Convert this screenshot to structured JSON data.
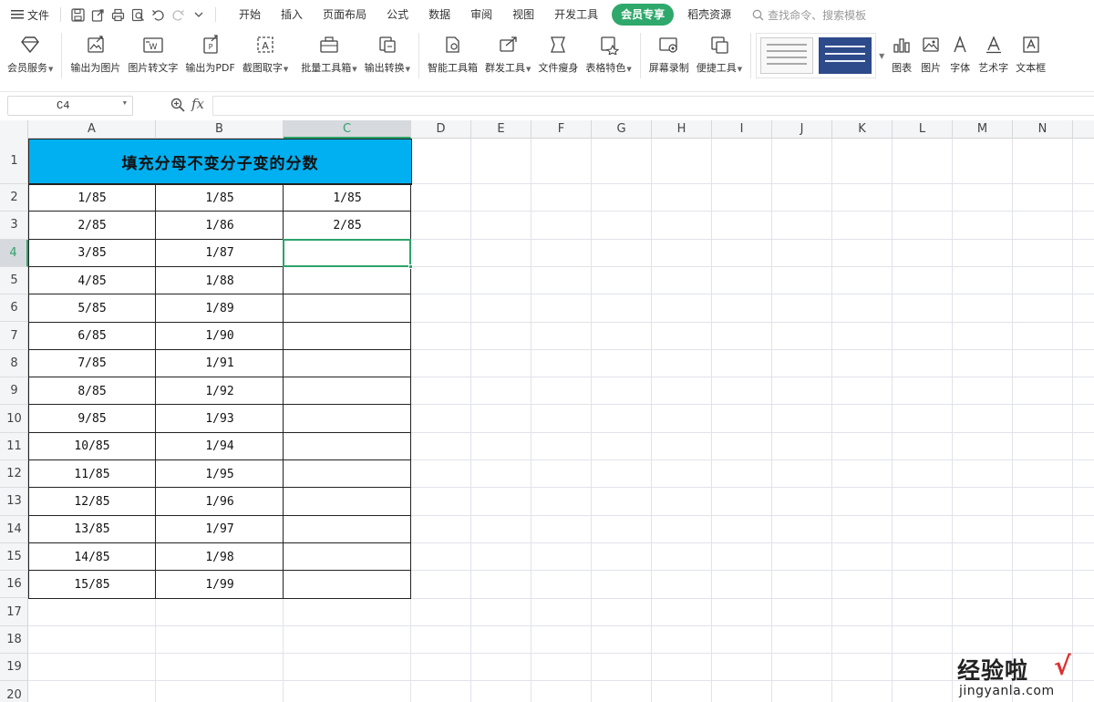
{
  "menubar": {
    "file_label": "文件",
    "tabs": [
      "开始",
      "插入",
      "页面布局",
      "公式",
      "数据",
      "审阅",
      "视图",
      "开发工具",
      "会员专享",
      "稻壳资源"
    ],
    "active_tab": "会员专享",
    "search_placeholder": "查找命令、搜索模板"
  },
  "ribbon": {
    "buttons": [
      {
        "label": "会员服务",
        "icon": "diamond-icon",
        "dropdown": true
      },
      {
        "label": "输出为图片",
        "icon": "export-image-icon",
        "dropdown": false
      },
      {
        "label": "图片转文字",
        "icon": "image-to-text-icon",
        "dropdown": false
      },
      {
        "label": "输出为PDF",
        "icon": "export-pdf-icon",
        "dropdown": false
      },
      {
        "label": "截图取字",
        "icon": "screenshot-text-icon",
        "dropdown": true
      },
      {
        "label": "批量工具箱",
        "icon": "toolbox-icon",
        "dropdown": true
      },
      {
        "label": "输出转换",
        "icon": "convert-icon",
        "dropdown": true
      },
      {
        "label": "智能工具箱",
        "icon": "smart-toolbox-icon",
        "dropdown": false
      },
      {
        "label": "群发工具",
        "icon": "mass-send-icon",
        "dropdown": true
      },
      {
        "label": "文件瘦身",
        "icon": "file-slim-icon",
        "dropdown": false
      },
      {
        "label": "表格特色",
        "icon": "table-feature-icon",
        "dropdown": true
      },
      {
        "label": "屏幕录制",
        "icon": "screen-record-icon",
        "dropdown": false
      },
      {
        "label": "便捷工具",
        "icon": "convenient-tools-icon",
        "dropdown": true
      }
    ],
    "right_buttons": [
      {
        "label": "图表",
        "icon": "chart-icon"
      },
      {
        "label": "图片",
        "icon": "picture-icon"
      },
      {
        "label": "字体",
        "icon": "font-icon"
      },
      {
        "label": "艺术字",
        "icon": "wordart-icon"
      },
      {
        "label": "文本框",
        "icon": "textbox-icon"
      }
    ]
  },
  "formula_bar": {
    "cell_ref": "C4",
    "fx_label": "fx",
    "formula": ""
  },
  "sheet": {
    "columns": [
      "A",
      "B",
      "C",
      "D",
      "E",
      "F",
      "G",
      "H",
      "I",
      "J",
      "K",
      "L",
      "M",
      "N"
    ],
    "selected_column": "C",
    "rows": [
      "1",
      "2",
      "3",
      "4",
      "5",
      "6",
      "7",
      "8",
      "9",
      "10",
      "11",
      "12",
      "13",
      "14",
      "15",
      "16",
      "17",
      "18",
      "19",
      "20"
    ],
    "selected_row": "4",
    "title": "填充分母不变分子变的分数",
    "data": [
      [
        "1/85",
        "1/85",
        "1/85"
      ],
      [
        "2/85",
        "1/86",
        "2/85"
      ],
      [
        "3/85",
        "1/87",
        ""
      ],
      [
        "4/85",
        "1/88",
        ""
      ],
      [
        "5/85",
        "1/89",
        ""
      ],
      [
        "6/85",
        "1/90",
        ""
      ],
      [
        "7/85",
        "1/91",
        ""
      ],
      [
        "8/85",
        "1/92",
        ""
      ],
      [
        "9/85",
        "1/93",
        ""
      ],
      [
        "10/85",
        "1/94",
        ""
      ],
      [
        "11/85",
        "1/95",
        ""
      ],
      [
        "12/85",
        "1/96",
        ""
      ],
      [
        "13/85",
        "1/97",
        ""
      ],
      [
        "14/85",
        "1/98",
        ""
      ],
      [
        "15/85",
        "1/99",
        ""
      ]
    ]
  },
  "watermark": {
    "top": "经验啦",
    "check": "√",
    "bottom": "jingyanla.com"
  },
  "colors": {
    "accent": "#2fa86b",
    "title_fill": "#00b0f0",
    "selection": "#2ea36a"
  }
}
